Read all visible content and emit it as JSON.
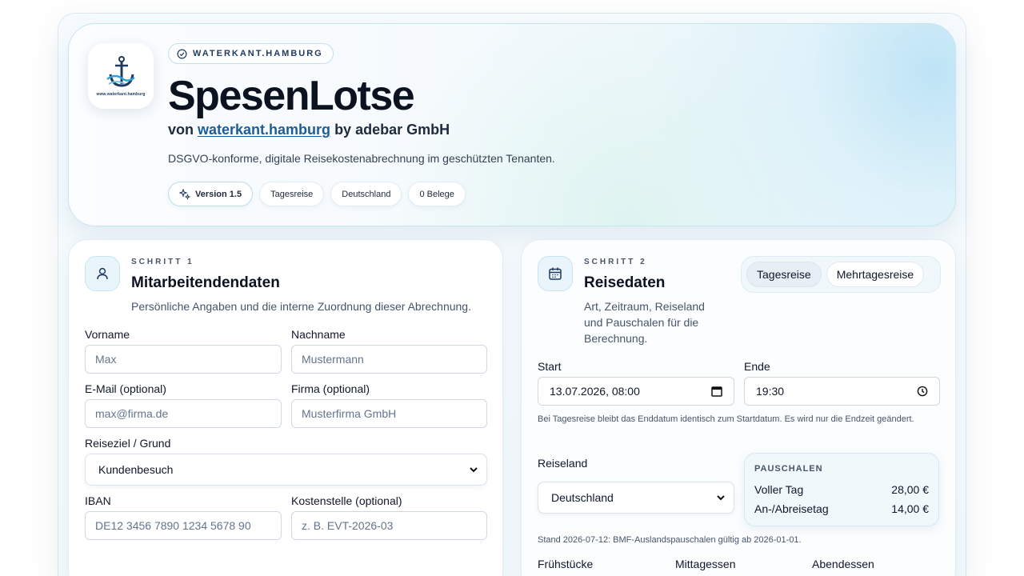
{
  "hero": {
    "brand_badge": "WATERKANT.HAMBURG",
    "logo_caption": "www.waterkant.hamburg",
    "title": "SpesenLotse",
    "subtitle_prefix": "von ",
    "subtitle_link": "waterkant.hamburg",
    "subtitle_suffix": " by adebar GmbH",
    "description": "DSGVO-konforme, digitale Reisekostenabrechnung im geschützten Tenanten.",
    "chips": {
      "version": "Version 1.5",
      "trip_type": "Tagesreise",
      "country": "Deutschland",
      "receipts": "0 Belege"
    }
  },
  "step1": {
    "kicker": "SCHRITT 1",
    "title": "Mitarbeitendendaten",
    "description": "Persönliche Angaben und die interne Zuordnung dieser Abrechnung.",
    "fields": {
      "first_name": {
        "label": "Vorname",
        "placeholder": "Max"
      },
      "last_name": {
        "label": "Nachname",
        "placeholder": "Mustermann"
      },
      "email": {
        "label": "E-Mail (optional)",
        "placeholder": "max@firma.de"
      },
      "company": {
        "label": "Firma (optional)",
        "placeholder": "Musterfirma GmbH"
      },
      "purpose": {
        "label": "Reiseziel / Grund",
        "value": "Kundenbesuch"
      },
      "iban": {
        "label": "IBAN",
        "placeholder": "DE12 3456 7890 1234 5678 90"
      },
      "cost_center": {
        "label": "Kostenstelle (optional)",
        "placeholder": "z. B. EVT-2026-03"
      }
    }
  },
  "step2": {
    "kicker": "SCHRITT 2",
    "title": "Reisedaten",
    "description": "Art, Zeitraum, Reiseland und Pauschalen für die Berechnung.",
    "toggle": {
      "day_trip": "Tagesreise",
      "multi_day": "Mehrtagesreise",
      "selected": "Tagesreise"
    },
    "start": {
      "label": "Start",
      "value": "13.07.2026, 08:00"
    },
    "end": {
      "label": "Ende",
      "value": "19:30"
    },
    "hint": "Bei Tagesreise bleibt das Enddatum identisch zum Startdatum. Es wird nur die Endzeit geändert.",
    "country": {
      "label": "Reiseland",
      "value": "Deutschland"
    },
    "allowances": {
      "title": "PAUSCHALEN",
      "full_day_label": "Voller Tag",
      "full_day_value": "28,00 €",
      "arrival_label": "An-/Abreisetag",
      "arrival_value": "14,00 €"
    },
    "status_note": "Stand 2026-07-12: BMF-Auslandspauschalen gültig ab 2026-01-01.",
    "meals": {
      "breakfast": "Frühstücke",
      "lunch": "Mittagessen",
      "dinner": "Abendessen"
    }
  },
  "colors": {
    "accent": "#1c5d99",
    "title": "#0b1220",
    "border": "#cfd8e2"
  }
}
